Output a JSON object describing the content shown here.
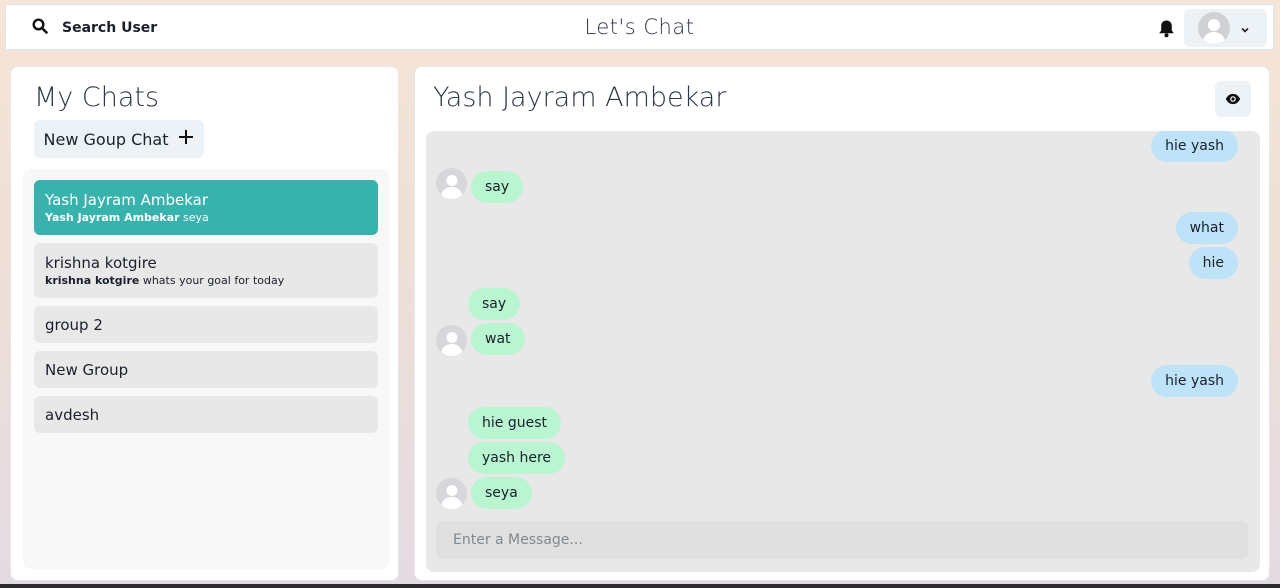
{
  "header": {
    "search_label": "Search User",
    "app_title": "Let's Chat",
    "icons": [
      "search-icon",
      "bell-icon",
      "avatar-icon",
      "chevron-down-icon"
    ]
  },
  "sidebar": {
    "title": "My Chats",
    "new_group_label": "New Goup Chat",
    "chats": [
      {
        "name": "Yash Jayram Ambekar",
        "preview_sender": "Yash Jayram Ambekar",
        "preview_text": "seya",
        "active": true
      },
      {
        "name": "krishna kotgire",
        "preview_sender": "krishna kotgire",
        "preview_text": "whats your goal for today",
        "active": false
      },
      {
        "name": "group 2",
        "active": false
      },
      {
        "name": "New Group",
        "active": false
      },
      {
        "name": "avdesh",
        "active": false
      }
    ]
  },
  "chat": {
    "title": "Yash Jayram Ambekar",
    "messages": [
      {
        "text": "hie yash",
        "side": "sent"
      },
      {
        "text": "say",
        "side": "received",
        "avatar": true
      },
      {
        "text": "what",
        "side": "sent"
      },
      {
        "text": "hie",
        "side": "sent"
      },
      {
        "text": "say",
        "side": "received",
        "avatar": false
      },
      {
        "text": "wat",
        "side": "received",
        "avatar": true
      },
      {
        "text": "hie yash",
        "side": "sent"
      },
      {
        "text": "hie guest",
        "side": "received",
        "avatar": false
      },
      {
        "text": "yash here",
        "side": "received",
        "avatar": false
      },
      {
        "text": "seya",
        "side": "received",
        "avatar": true
      }
    ],
    "input_placeholder": "Enter a Message..."
  },
  "colors": {
    "active_chat": "#38b2ac",
    "sent_bubble": "#bee3f8",
    "received_bubble": "#b9f5d0"
  }
}
